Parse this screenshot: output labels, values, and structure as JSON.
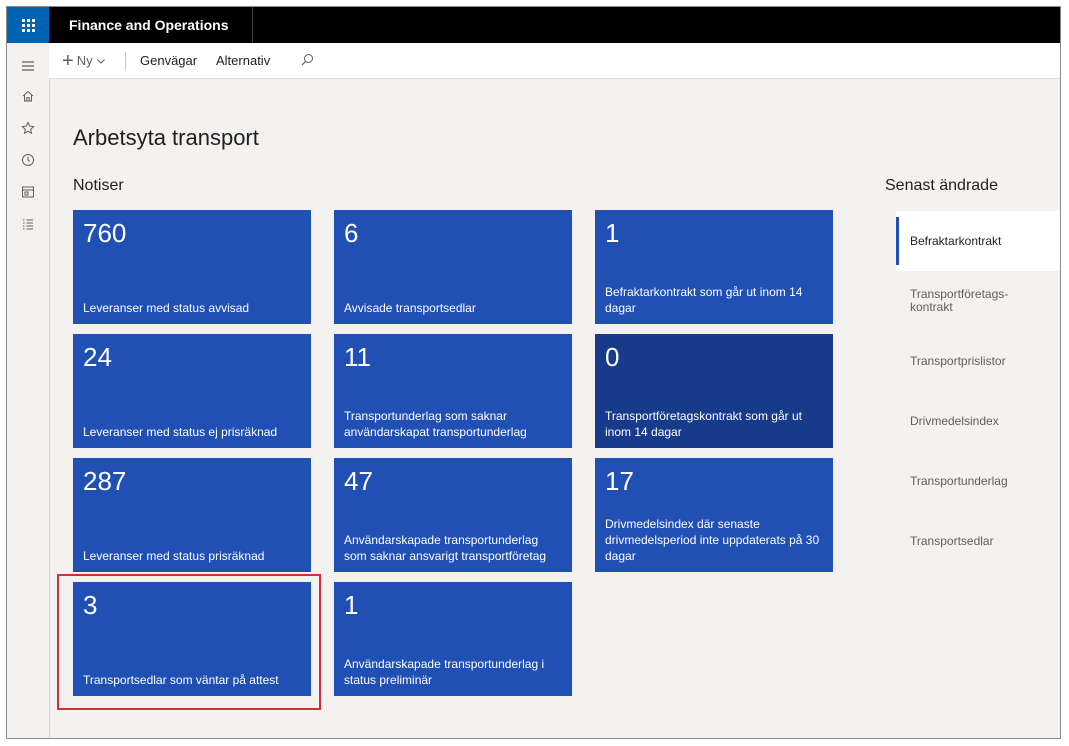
{
  "app": {
    "title": "Finance and Operations"
  },
  "nav_rail": {
    "items": [
      {
        "name": "hamburger-icon"
      },
      {
        "name": "home-icon"
      },
      {
        "name": "star-icon"
      },
      {
        "name": "clock-icon"
      },
      {
        "name": "workspace-icon"
      },
      {
        "name": "list-icon"
      }
    ]
  },
  "action_pane": {
    "new_label": "Ny",
    "shortcuts_label": "Genvägar",
    "options_label": "Alternativ",
    "search_icon": "search-icon"
  },
  "page": {
    "title": "Arbetsyta transport",
    "notices_heading": "Notiser"
  },
  "tiles": [
    {
      "count": "760",
      "label": "Leveranser med status avvisad"
    },
    {
      "count": "6",
      "label": "Avvisade transportsedlar"
    },
    {
      "count": "1",
      "label": "Befraktarkontrakt som går ut inom 14 dagar"
    },
    {
      "count": "24",
      "label": "Leveranser med status ej prisräknad"
    },
    {
      "count": "11",
      "label": "Transportunderlag som saknar användarskapat transportunderlag"
    },
    {
      "count": "0",
      "label": "Transportföretagskontrakt som går ut inom 14 dagar"
    },
    {
      "count": "287",
      "label": "Leveranser med status prisräknad"
    },
    {
      "count": "47",
      "label": "Användarskapade transportunderlag som saknar ansvarigt transportföretag"
    },
    {
      "count": "17",
      "label": "Drivmedelsindex där senaste drivmedelsperiod inte uppdaterats på 30 dagar"
    },
    {
      "count": "3",
      "label": "Transportsedlar som väntar på attest"
    },
    {
      "count": "1",
      "label": "Användarskapade transportunderlag i status preliminär"
    }
  ],
  "recent": {
    "heading": "Senast ändrade",
    "items": [
      {
        "label": "Befraktarkontrakt"
      },
      {
        "label": "Transportföretags-\nkontrakt"
      },
      {
        "label": "Transportprislistor"
      },
      {
        "label": "Drivmedelsindex"
      },
      {
        "label": "Transportunderlag"
      },
      {
        "label": "Transportsedlar"
      }
    ]
  },
  "colors": {
    "tile": "#2150b5",
    "tile_dark": "#173a8a",
    "highlight": "#d42e3a",
    "topbar": "#000000",
    "waffle": "#0063b1"
  }
}
